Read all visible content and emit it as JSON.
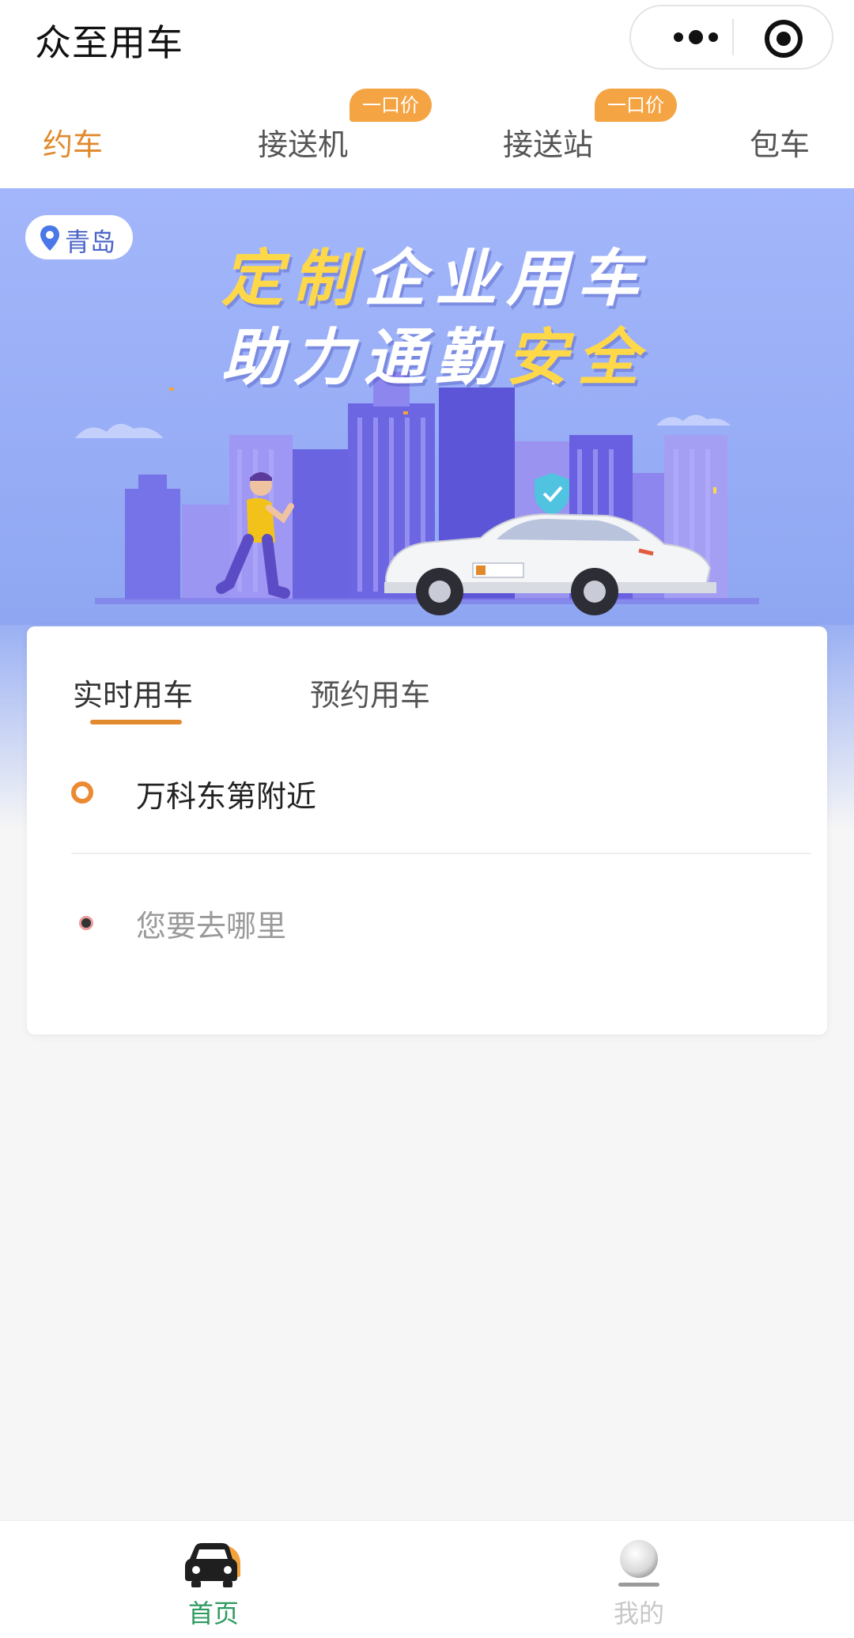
{
  "app": {
    "title": "众至用车"
  },
  "service_tabs": [
    {
      "label": "约车",
      "active": true,
      "badge": ""
    },
    {
      "label": "接送机",
      "active": false,
      "badge": "一口价"
    },
    {
      "label": "接送站",
      "active": false,
      "badge": "一口价"
    },
    {
      "label": "包车",
      "active": false,
      "badge": ""
    }
  ],
  "banner": {
    "city": "青岛",
    "slogan_line1_a": "定制",
    "slogan_line1_b": "企业用车",
    "slogan_line2_a": "助力通勤",
    "slogan_line2_b": "安全"
  },
  "ride": {
    "tabs": [
      {
        "label": "实时用车",
        "active": true
      },
      {
        "label": "预约用车",
        "active": false
      }
    ],
    "origin": "万科东第附近",
    "destination_placeholder": "您要去哪里"
  },
  "bottom_nav": [
    {
      "label": "首页",
      "active": true,
      "icon": "car-icon"
    },
    {
      "label": "我的",
      "active": false,
      "icon": "profile-icon"
    }
  ],
  "colors": {
    "accent": "#e08a2c",
    "badge": "#f5a443",
    "nav_active": "#2e9a5f",
    "banner_bg": "#9ab0f3"
  }
}
